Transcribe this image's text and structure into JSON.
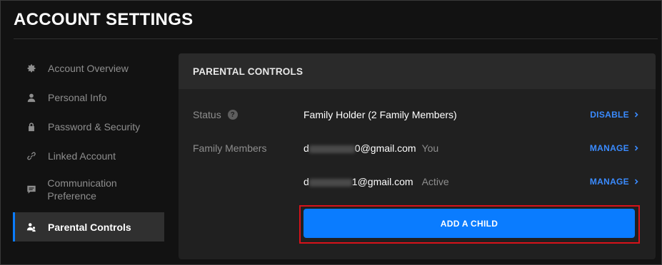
{
  "page": {
    "title": "ACCOUNT SETTINGS"
  },
  "sidebar": {
    "items": [
      {
        "label": "Account Overview",
        "icon": "gear-icon"
      },
      {
        "label": "Personal Info",
        "icon": "user-icon"
      },
      {
        "label": "Password & Security",
        "icon": "lock-icon"
      },
      {
        "label": "Linked Account",
        "icon": "link-icon"
      },
      {
        "label": "Communication Preference",
        "icon": "message-icon"
      },
      {
        "label": "Parental Controls",
        "icon": "family-icon",
        "active": true
      }
    ]
  },
  "panel": {
    "title": "PARENTAL CONTROLS",
    "status": {
      "label": "Status",
      "help": "?",
      "value": "Family Holder (2 Family Members)",
      "action": "DISABLE"
    },
    "members": {
      "label": "Family Members",
      "rows": [
        {
          "email_prefix": "d",
          "email_suffix": "0@gmail.com",
          "tag": "You",
          "action": "MANAGE"
        },
        {
          "email_prefix": "d",
          "email_suffix": "1@gmail.com",
          "tag": "Active",
          "action": "MANAGE"
        }
      ]
    },
    "add_button": "ADD A CHILD"
  },
  "colors": {
    "accent": "#0a7cff",
    "link": "#3a8bff",
    "highlight": "#d8121a",
    "background": "#121212",
    "panel": "#202020"
  }
}
